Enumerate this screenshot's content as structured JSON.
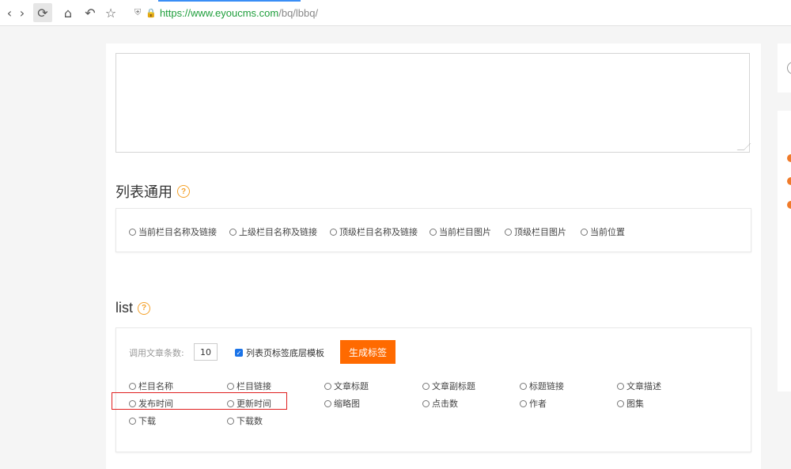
{
  "browser": {
    "url_scheme_host": "https://www.eyoucms.com",
    "url_path": "/bq/lbbq/"
  },
  "sections": {
    "list_general": {
      "title": "列表通用",
      "options": [
        "当前栏目名称及链接",
        "上级栏目名称及链接",
        "顶级栏目名称及链接",
        "当前栏目图片",
        "顶级栏目图片",
        "当前位置"
      ]
    },
    "list": {
      "title": "list",
      "count_label": "调用文章条数:",
      "count_value": "10",
      "checkbox_label": "列表页标签底层模板",
      "checkbox_checked": true,
      "generate_button": "生成标签",
      "options": [
        [
          "栏目名称",
          "栏目链接",
          "文章标题",
          "文章副标题",
          "标题链接",
          "文章描述"
        ],
        [
          "发布时间",
          "更新时间",
          "缩略图",
          "点击数",
          "作者",
          "图集"
        ],
        [
          "下载",
          "下载数"
        ]
      ]
    }
  },
  "colors": {
    "accent": "#ff6a00",
    "help_icon": "#f4a12a",
    "highlight": "#e02020",
    "secure_url": "#1e9e3b"
  }
}
